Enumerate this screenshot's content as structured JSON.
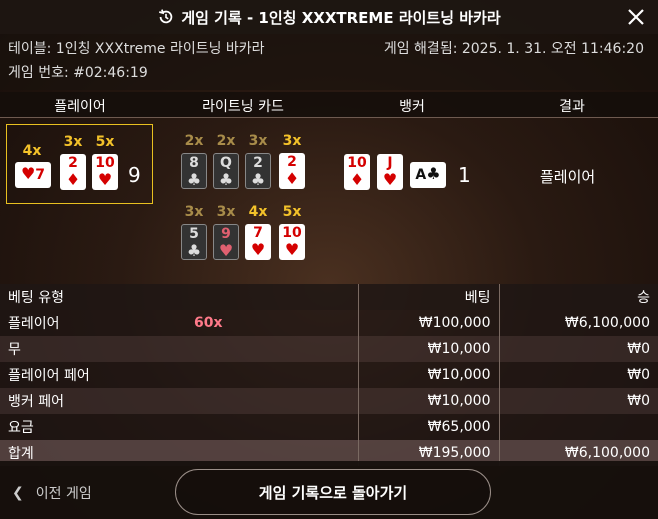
{
  "header": {
    "title": "게임 기록 - 1인칭 XXXTREME 라이트닝 바카라"
  },
  "info": {
    "table": "테이블: 1인칭 XXXtreme 라이트닝 바카라",
    "game_no": "게임 번호: #02:46:19",
    "resolved": "게임 해결됨: 2025. 1. 31. 오전 11:46:20"
  },
  "columns": {
    "player": "플레이어",
    "lightning": "라이트닝 카드",
    "banker": "뱅커",
    "result": "결과"
  },
  "player": {
    "score": "9",
    "cards": [
      {
        "mult": "4x",
        "rank": "7",
        "suit": "♥"
      },
      {
        "mult": "3x",
        "rank": "2",
        "suit": "♦"
      },
      {
        "mult": "5x",
        "rank": "10",
        "suit": "♥"
      }
    ]
  },
  "lightning": {
    "cards": [
      {
        "mult": "2x",
        "rank": "8",
        "suit": "♣"
      },
      {
        "mult": "2x",
        "rank": "Q",
        "suit": "♣"
      },
      {
        "mult": "3x",
        "rank": "2",
        "suit": "♣"
      },
      {
        "mult": "3x",
        "rank": "2",
        "suit": "♦"
      },
      {
        "mult": "3x",
        "rank": "5",
        "suit": "♣"
      },
      {
        "mult": "3x",
        "rank": "9",
        "suit": "♥"
      },
      {
        "mult": "4x",
        "rank": "7",
        "suit": "♥"
      },
      {
        "mult": "5x",
        "rank": "10",
        "suit": "♥"
      }
    ]
  },
  "banker": {
    "score": "1",
    "cards": [
      {
        "rank": "10",
        "suit": "♦"
      },
      {
        "rank": "J",
        "suit": "♥"
      },
      {
        "rank": "A",
        "suit": "♣"
      }
    ]
  },
  "result": "플레이어",
  "bets": {
    "headers": [
      "베팅 유형",
      "베팅",
      "승"
    ],
    "rows": [
      {
        "type": "플레이어",
        "badge": "60x",
        "bet": "₩100,000",
        "win": "₩6,100,000"
      },
      {
        "type": "무",
        "bet": "₩10,000",
        "win": "₩0"
      },
      {
        "type": "플레이어 페어",
        "bet": "₩10,000",
        "win": "₩0"
      },
      {
        "type": "뱅커 페어",
        "bet": "₩10,000",
        "win": "₩0"
      },
      {
        "type": "요금",
        "bet": "₩65,000",
        "win": ""
      },
      {
        "type": "합계",
        "bet": "₩195,000",
        "win": "₩6,100,000"
      }
    ]
  },
  "footer": {
    "prev": "이전 게임",
    "back": "게임 기록으로 돌아가기"
  },
  "colors": {
    "accent": "#f3c22a",
    "highlight_border": "#e8c020",
    "red_suit": "#d40000",
    "badge": "#ff7a8a"
  }
}
